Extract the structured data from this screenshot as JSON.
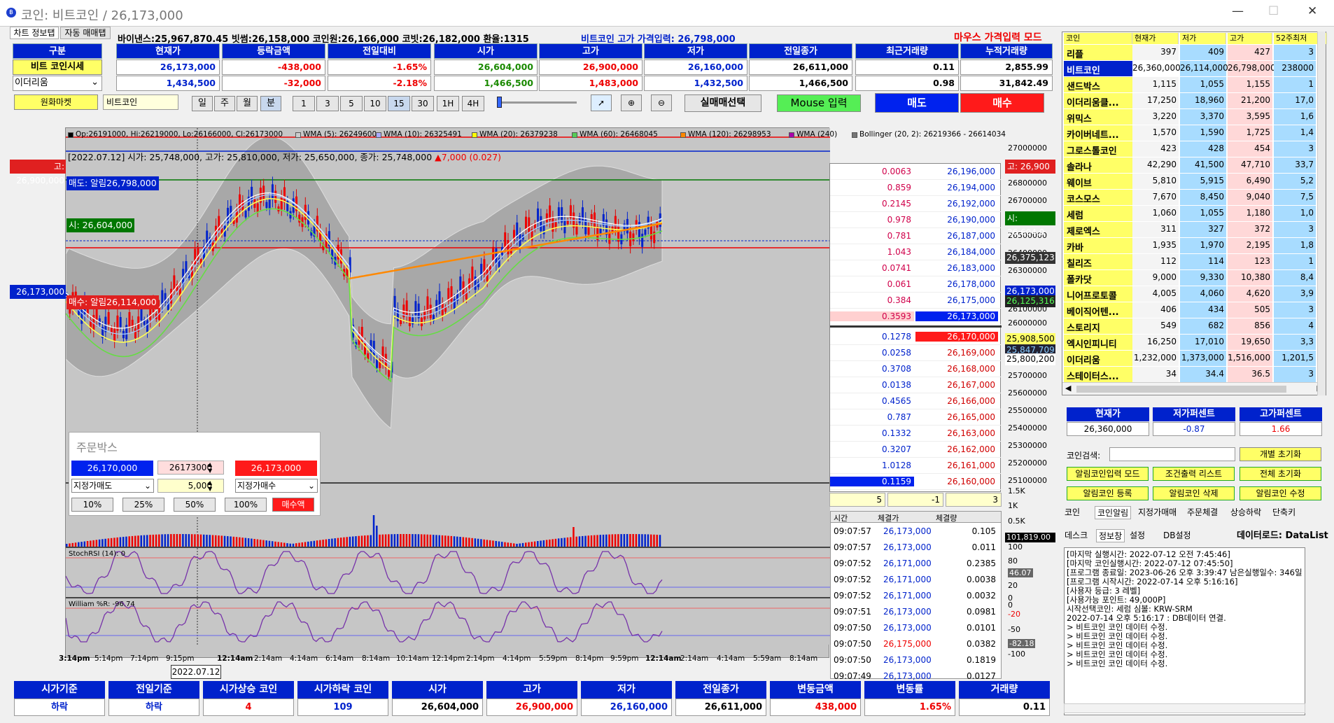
{
  "window": {
    "title": "코인: 비트코인 / 26,173,000"
  },
  "tabs": [
    "차트 정보탭",
    "자동 매매탭"
  ],
  "ticker_line": "바이낸스:25,967,870.45 빗썸:26,158,000 코인원:26,166,000 코빗:26,182,000 환율:1315",
  "high_input": "비트코인 고가 가격입력: 26,798,000",
  "mouse_mode": "마우스 가격입력 모드",
  "summary": {
    "headers": [
      "구분",
      "현재가",
      "등락금액",
      "전일대비",
      "시가",
      "고가",
      "저가",
      "전일종가",
      "최근거래량",
      "누적거래량"
    ],
    "row1_label": "비트 코인시세",
    "row1": [
      "26,173,000",
      "-438,000",
      "-1.65%",
      "26,604,000",
      "26,900,000",
      "26,160,000",
      "26,611,000",
      "0.11",
      "2,855.99"
    ],
    "row2_label": "이더리움",
    "row2": [
      "1,434,500",
      "-32,000",
      "-2.18%",
      "1,466,500",
      "1,483,000",
      "1,432,500",
      "1,466,500",
      "0.98",
      "31,842.49"
    ]
  },
  "toolbar": {
    "market": "원화마켓",
    "coin": "비트코인",
    "periods": [
      "일",
      "주",
      "월",
      "분"
    ],
    "minutes": [
      "1",
      "3",
      "5",
      "10",
      "15",
      "30",
      "1H",
      "4H"
    ],
    "select_trade": "실매매선택",
    "mouse_input": "Mouse 입력",
    "sell": "매도",
    "buy": "매수"
  },
  "chart": {
    "legend": [
      "Op:26191000, Hi:26219000, Lo:26166000, Cl:26173000",
      "WMA (5): 26249600",
      "WMA (10): 26325491",
      "WMA (20): 26379238",
      "WMA (60): 26468045",
      "WMA (120): 26298953",
      "WMA (240)",
      "Bollinger (20, 2): 26219366 - 26614034"
    ],
    "info": "[2022.07.12]  시가: 25,748,000, 고가: 25,810,000, 저가: 25,650,000, 종가: 25,748,000",
    "info_change": "▲7,000 (0.027)",
    "label_high": "고: 26,900,000",
    "label_sell_alarm": "매도: 알림26,798,000",
    "label_open": "시: 26,604,000",
    "label_current": "26,173,000",
    "label_buy_alarm": "매수: 알림26,114,000",
    "right_high": "고: 26,900",
    "right_open": "시: 26,604,0",
    "right_vals": [
      "26,375,123",
      "26,173,000",
      "26,125,316",
      "25,908,500",
      "25,847,709",
      "25,800,200"
    ],
    "y_ticks": [
      "27000000",
      "26800000",
      "26700000",
      "26600000",
      "26500000",
      "26400000",
      "26300000",
      "26200000",
      "26100000",
      "26000000",
      "25900000",
      "25800000",
      "25700000",
      "25600000",
      "25500000",
      "25400000",
      "25300000",
      "25200000",
      "25100000"
    ],
    "vol_ticks": [
      "1.5K",
      "1K",
      "0.5K",
      "0K"
    ],
    "vol_value": "101,819.00",
    "stoch_title": "StochRSI (14): 0",
    "stoch_ticks": [
      "100",
      "80",
      "46.07",
      "20",
      "0"
    ],
    "will_title": "William %R: -96.74",
    "will_ticks": [
      "0",
      "-20",
      "-50",
      "-82.18",
      "-100"
    ],
    "x_ticks": [
      "3:14pm",
      "5:14pm",
      "7:14pm",
      "9:15pm",
      "12:14am",
      "2:14am",
      "4:14am",
      "6:14am",
      "8:14am",
      "10:14am",
      "12:14pm",
      "2:14pm",
      "4:14pm",
      "5:59pm",
      "8:14pm",
      "9:59pm",
      "12:14am",
      "2:14am",
      "4:14am",
      "5:59am",
      "8:14am"
    ],
    "date_label": "2022.07.12"
  },
  "orderbook": {
    "asks": [
      [
        "0.0063",
        "26,196,000"
      ],
      [
        "0.859",
        "26,194,000"
      ],
      [
        "0.2145",
        "26,192,000"
      ],
      [
        "0.978",
        "26,190,000"
      ],
      [
        "0.781",
        "26,187,000"
      ],
      [
        "1.043",
        "26,184,000"
      ],
      [
        "0.0741",
        "26,183,000"
      ],
      [
        "0.061",
        "26,178,000"
      ],
      [
        "0.384",
        "26,175,000"
      ],
      [
        "0.3593",
        "26,173,000"
      ]
    ],
    "bids": [
      [
        "0.1278",
        "26,170,000"
      ],
      [
        "0.0258",
        "26,169,000"
      ],
      [
        "0.3708",
        "26,168,000"
      ],
      [
        "0.0138",
        "26,167,000"
      ],
      [
        "0.4565",
        "26,166,000"
      ],
      [
        "0.787",
        "26,165,000"
      ],
      [
        "0.1332",
        "26,163,000"
      ],
      [
        "0.3207",
        "26,162,000"
      ],
      [
        "1.0128",
        "26,161,000"
      ],
      [
        "0.1159",
        "26,160,000"
      ]
    ],
    "counts": [
      "5",
      "-1",
      "3"
    ]
  },
  "trades": {
    "headers": [
      "시간",
      "체결가",
      "체결량"
    ],
    "rows": [
      [
        "09:07:57",
        "26,173,000",
        "0.105"
      ],
      [
        "09:07:57",
        "26,173,000",
        "0.011"
      ],
      [
        "09:07:52",
        "26,171,000",
        "0.2385"
      ],
      [
        "09:07:52",
        "26,171,000",
        "0.0038"
      ],
      [
        "09:07:52",
        "26,171,000",
        "0.0032"
      ],
      [
        "09:07:51",
        "26,173,000",
        "0.0981"
      ],
      [
        "09:07:50",
        "26,173,000",
        "0.0101"
      ],
      [
        "09:07:50",
        "26,175,000",
        "0.0382"
      ],
      [
        "09:07:50",
        "26,173,000",
        "0.1819"
      ],
      [
        "09:07:49",
        "26,173,000",
        "0.0127"
      ]
    ]
  },
  "orderbox": {
    "title": "주문박스",
    "sell_price": "26,170,000",
    "input_price": "26173000",
    "buy_price": "26,173,000",
    "qty": "5,000",
    "sell_type": "지정가매도",
    "buy_type": "지정가매수",
    "pcts": [
      "10%",
      "25%",
      "50%",
      "100%"
    ],
    "buy_amt": "매수액"
  },
  "bottom": {
    "headers": [
      "시가기준",
      "전일기준",
      "시가상승 코인",
      "시가하락 코인",
      "시가",
      "고가",
      "저가",
      "전일종가",
      "변동금액",
      "변동률",
      "거래량"
    ],
    "values": [
      "하락",
      "하락",
      "4",
      "109",
      "26,604,000",
      "26,900,000",
      "26,160,000",
      "26,611,000",
      "438,000",
      "1.65%",
      "0.11"
    ]
  },
  "coinlist": {
    "headers": [
      "코인",
      "현재가",
      "저가",
      "고가",
      "52주최저"
    ],
    "rows": [
      [
        "리플",
        "397",
        "409",
        "427",
        "3"
      ],
      [
        "비트코인",
        "26,360,000",
        "26,114,000",
        "26,798,000",
        "238000"
      ],
      [
        "샌드박스",
        "1,115",
        "1,055",
        "1,155",
        "1"
      ],
      [
        "이더리움클...",
        "17,250",
        "18,960",
        "21,200",
        "17,0"
      ],
      [
        "위믹스",
        "3,220",
        "3,370",
        "3,595",
        "1,6"
      ],
      [
        "카이버네트...",
        "1,570",
        "1,590",
        "1,725",
        "1,4"
      ],
      [
        "그로스톨코인",
        "423",
        "428",
        "454",
        "3"
      ],
      [
        "솔라나",
        "42,290",
        "41,500",
        "47,710",
        "33,7"
      ],
      [
        "웨이브",
        "5,810",
        "5,915",
        "6,490",
        "5,2"
      ],
      [
        "코스모스",
        "7,670",
        "8,450",
        "9,040",
        "7,5"
      ],
      [
        "세럼",
        "1,060",
        "1,055",
        "1,180",
        "1,0"
      ],
      [
        "제로엑스",
        "311",
        "327",
        "372",
        "3"
      ],
      [
        "카바",
        "1,935",
        "1,970",
        "2,195",
        "1,8"
      ],
      [
        "칠리즈",
        "112",
        "114",
        "123",
        "1"
      ],
      [
        "폴카닷",
        "9,000",
        "9,330",
        "10,380",
        "8,4"
      ],
      [
        "니어프로토콜",
        "4,005",
        "4,060",
        "4,620",
        "3,9"
      ],
      [
        "베이직어텐...",
        "406",
        "434",
        "505",
        "3"
      ],
      [
        "스토리지",
        "549",
        "682",
        "856",
        "4"
      ],
      [
        "엑시인피니티",
        "16,250",
        "17,010",
        "19,650",
        "3,3"
      ],
      [
        "이더리움",
        "1,232,000",
        "1,373,000",
        "1,516,000",
        "1,201,5"
      ],
      [
        "스테이터스...",
        "34",
        "34.4",
        "36.5",
        "3"
      ]
    ]
  },
  "pct_panel": {
    "headers": [
      "현재가",
      "저가퍼센트",
      "고가퍼센트"
    ],
    "values": [
      "26,360,000",
      "-0.87",
      "1.66"
    ]
  },
  "search": {
    "label": "코인검색:",
    "reset": "개별 초기화"
  },
  "side_buttons": [
    "알림코인입력 모드",
    "조건출력 리스트",
    "전체 초기화",
    "알림코인 등록",
    "알림코인 삭제",
    "알림코인 수정"
  ],
  "side_tabs1": [
    "코인",
    "코인알림",
    "지정가매매",
    "주문체결",
    "상승하락",
    "단축키"
  ],
  "side_tabs2": [
    "데스크",
    "정보창",
    "설정",
    "DB설정"
  ],
  "dataload": "데이터로드: DataList",
  "log_lines": [
    "[마지막 실행시간: 2022-07-12 오전 7:45:46]",
    "[마지막 코인실행시간: 2022-07-12 07:45:50]",
    "[프로그램 종료일: 2023-06-26 오후 3:39:47 남은실행일수: 346일]",
    "[프로그램 시작시간: 2022-07-14 오후 5:16:16]",
    "[사용자 등급: 3 레벨]",
    "[사용가능 포인트: 49,000P]",
    "시작선택코인: 세럼 심볼: KRW-SRM",
    "2022-07-14 오후 5:16:17 : DB데이터 연결.",
    "> 비트코인 코인 데이터 수정.",
    "> 비트코인 코인 데이터 수정.",
    "> 비트코인 코인 데이터 수정.",
    "> 비트코인 코인 데이터 수정.",
    "> 비트코인 코인 데이터 수정."
  ],
  "colors": {
    "blue": "#0022cc",
    "red": "#ff0000",
    "yellow": "#ffff66",
    "chart_bg": "#c6c6c6"
  }
}
